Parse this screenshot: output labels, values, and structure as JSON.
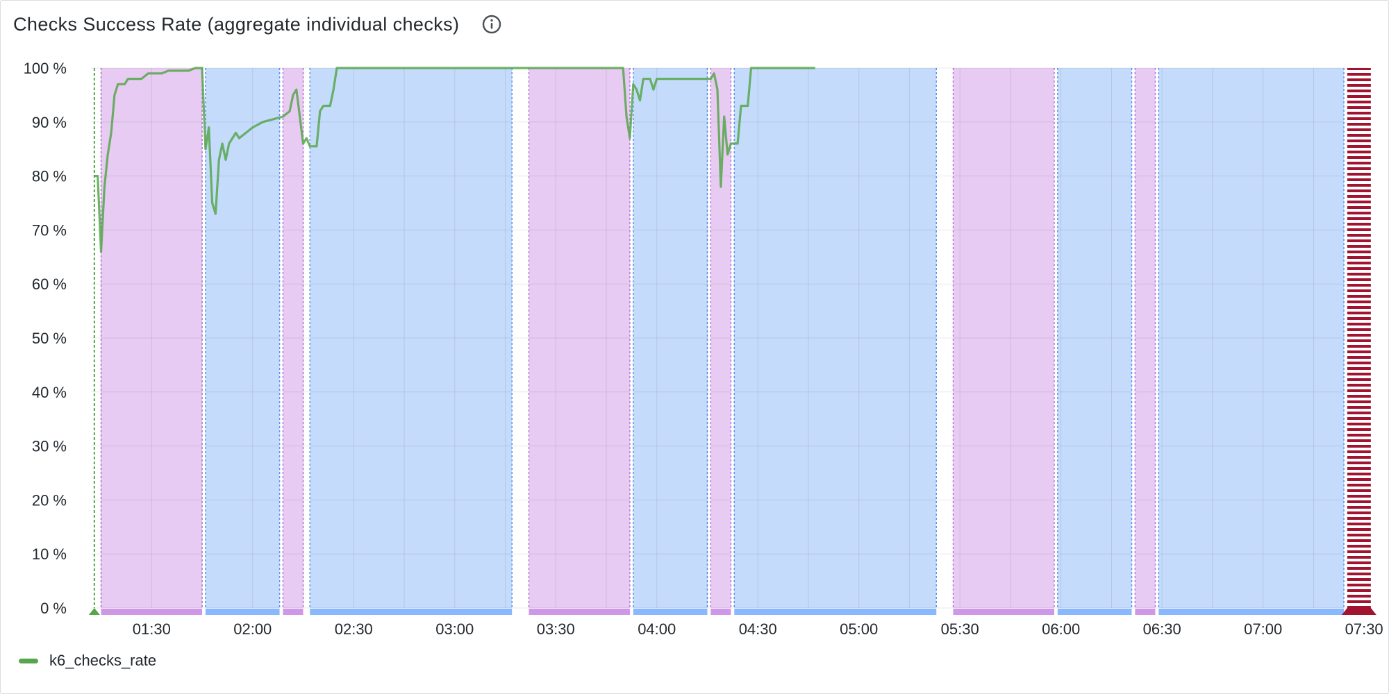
{
  "panel": {
    "title": "Checks Success Rate (aggregate individual checks)",
    "info_icon": "info-circle-icon"
  },
  "colors": {
    "series": "#56a64b",
    "series_dim": "#8f9491",
    "region_a": "#e7cbf2",
    "region_a_bar": "#cf97e7",
    "region_a_border": "#b877d9",
    "region_b": "#c5dbfb",
    "region_b_bar": "#8ab8ff",
    "region_b_border": "#5794f2",
    "start_marker": "#56a64b",
    "end_marker": "#a2132f"
  },
  "chart_data": {
    "type": "line",
    "title": "Checks Success Rate (aggregate individual checks)",
    "xlabel": "",
    "ylabel": "",
    "x_unit": "clock time (hh:mm)",
    "xlim": [
      "01:12",
      "07:31"
    ],
    "ylim": [
      0,
      100
    ],
    "y_ticks": [
      "0 %",
      "10 %",
      "20 %",
      "30 %",
      "40 %",
      "50 %",
      "60 %",
      "70 %",
      "80 %",
      "90 %",
      "100 %"
    ],
    "x_ticks": [
      "01:30",
      "02:00",
      "02:30",
      "03:00",
      "03:30",
      "04:00",
      "04:30",
      "05:00",
      "05:30",
      "06:00",
      "06:30",
      "07:00",
      "07:30"
    ],
    "grid": true,
    "legend_position": "bottom-left",
    "series": [
      {
        "name": "k6_checks_rate",
        "color": "#56a64b",
        "points": [
          [
            "01:13",
            80
          ],
          [
            "01:14",
            80
          ],
          [
            "01:15",
            66
          ],
          [
            "01:16",
            78
          ],
          [
            "01:17",
            84
          ],
          [
            "01:18",
            88
          ],
          [
            "01:19",
            95
          ],
          [
            "01:20",
            97
          ],
          [
            "01:22",
            97
          ],
          [
            "01:23",
            98
          ],
          [
            "01:27",
            98
          ],
          [
            "01:29",
            99
          ],
          [
            "01:33",
            99
          ],
          [
            "01:35",
            99.5
          ],
          [
            "01:41",
            99.5
          ],
          [
            "01:43",
            100
          ],
          [
            "01:45",
            100
          ],
          [
            "01:46",
            85
          ],
          [
            "01:47",
            89
          ],
          [
            "01:48",
            75
          ],
          [
            "01:49",
            73
          ],
          [
            "01:50",
            83
          ],
          [
            "01:51",
            86
          ],
          [
            "01:52",
            83
          ],
          [
            "01:53",
            86
          ],
          [
            "01:54",
            87
          ],
          [
            "01:55",
            88
          ],
          [
            "01:56",
            87
          ],
          [
            "01:58",
            88
          ],
          [
            "02:00",
            89
          ],
          [
            "02:03",
            90
          ],
          [
            "02:06",
            90.5
          ],
          [
            "02:09",
            91
          ],
          [
            "02:11",
            92
          ],
          [
            "02:12",
            95
          ],
          [
            "02:13",
            96
          ],
          [
            "02:14",
            91
          ],
          [
            "02:15",
            86
          ],
          [
            "02:16",
            87
          ],
          [
            "02:17",
            85.5
          ],
          [
            "02:19",
            85.5
          ],
          [
            "02:20",
            92
          ],
          [
            "02:21",
            93
          ],
          [
            "02:23",
            93
          ],
          [
            "02:24",
            96
          ],
          [
            "02:25",
            100
          ],
          [
            "03:50",
            100
          ],
          [
            "03:51",
            91
          ],
          [
            "03:52",
            87
          ],
          [
            "03:53",
            97
          ],
          [
            "03:54",
            96
          ],
          [
            "03:55",
            94
          ],
          [
            "03:56",
            98
          ],
          [
            "03:58",
            98
          ],
          [
            "03:59",
            96
          ],
          [
            "04:00",
            98
          ],
          [
            "04:16",
            98
          ],
          [
            "04:17",
            99
          ],
          [
            "04:18",
            96
          ],
          [
            "04:19",
            78
          ],
          [
            "04:20",
            91
          ],
          [
            "04:21",
            84
          ],
          [
            "04:22",
            86
          ],
          [
            "04:24",
            86
          ],
          [
            "04:25",
            93
          ],
          [
            "04:27",
            93
          ],
          [
            "04:28",
            100
          ],
          [
            "04:47",
            100
          ]
        ]
      }
    ],
    "regions": [
      {
        "from": "01:15",
        "to": "01:45",
        "kind": "a"
      },
      {
        "from": "01:46",
        "to": "02:08",
        "kind": "b"
      },
      {
        "from": "02:09",
        "to": "02:15",
        "kind": "a"
      },
      {
        "from": "02:17",
        "to": "03:17",
        "kind": "b"
      },
      {
        "from": "03:22",
        "to": "03:52",
        "kind": "a"
      },
      {
        "from": "03:53",
        "to": "04:15",
        "kind": "b"
      },
      {
        "from": "04:16",
        "to": "04:22",
        "kind": "a"
      },
      {
        "from": "04:23",
        "to": "05:23",
        "kind": "b"
      },
      {
        "from": "05:28",
        "to": "05:58",
        "kind": "a"
      },
      {
        "from": "05:59",
        "to": "06:21",
        "kind": "b"
      },
      {
        "from": "06:22",
        "to": "06:28",
        "kind": "a"
      },
      {
        "from": "06:29",
        "to": "07:24",
        "kind": "b"
      }
    ],
    "markers": [
      {
        "at": "01:13",
        "kind": "start"
      },
      {
        "at": "07:25",
        "to": "07:32",
        "kind": "end"
      }
    ]
  },
  "legend": {
    "items": [
      {
        "name": "k6_checks_rate",
        "color": "#56a64b"
      }
    ]
  }
}
